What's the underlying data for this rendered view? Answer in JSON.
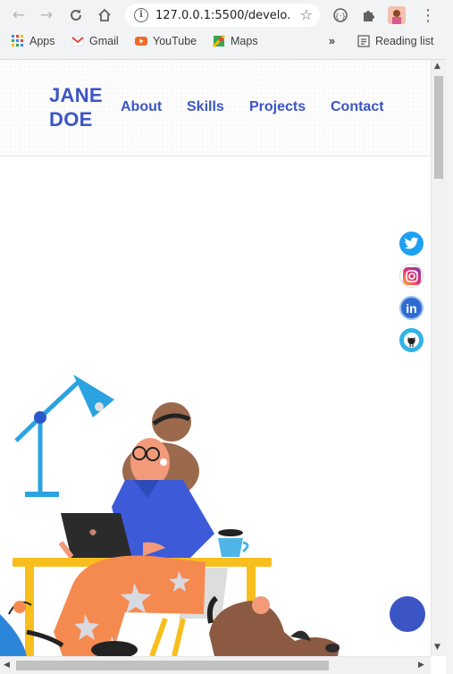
{
  "browser": {
    "url": "127.0.0.1:5500/develo...",
    "bookmarks": [
      {
        "label": "Apps",
        "icon": "apps-grid-icon"
      },
      {
        "label": "Gmail",
        "icon": "gmail-icon"
      },
      {
        "label": "YouTube",
        "icon": "youtube-icon"
      },
      {
        "label": "Maps",
        "icon": "maps-icon"
      }
    ],
    "overflow": "»",
    "reading_list": "Reading list"
  },
  "site": {
    "logo_line1": "JANE",
    "logo_line2": "DOE",
    "nav": [
      {
        "label": "About"
      },
      {
        "label": "Skills"
      },
      {
        "label": "Projects"
      },
      {
        "label": "Contact"
      }
    ],
    "social": [
      {
        "name": "twitter",
        "color": "#1da1f2"
      },
      {
        "name": "instagram",
        "color": "#e1306c"
      },
      {
        "name": "linkedin",
        "color": "#2f6bd0"
      },
      {
        "name": "github",
        "color": "#33b3e6"
      }
    ],
    "accent": "#3b55c5"
  }
}
